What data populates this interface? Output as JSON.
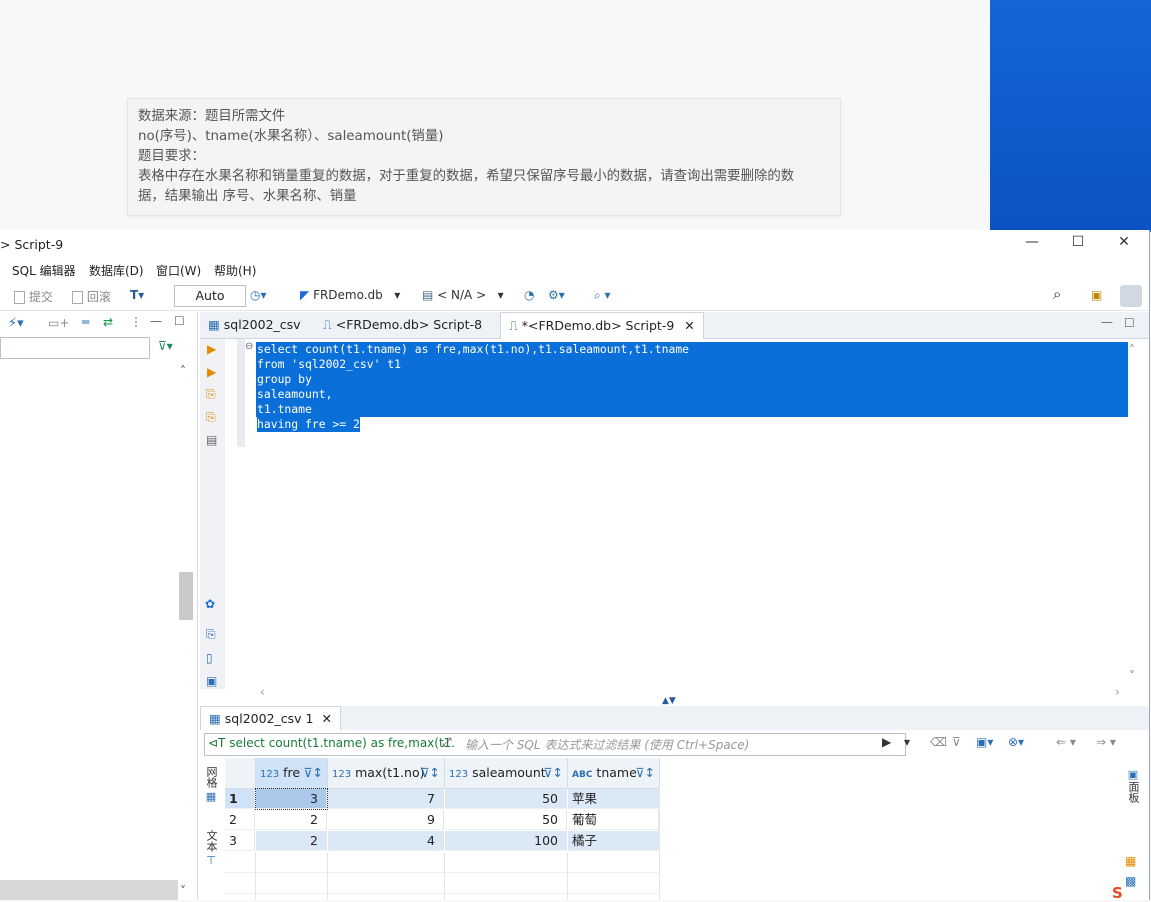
{
  "note": {
    "line1": "数据来源：题目所需文件",
    "line2": "no(序号)、tname(水果名称）、saleamount(销量)",
    "line3": "题目要求：",
    "line4": "表格中存在水果名称和销量重复的数据，对于重复的数据，希望只保留序号最小的数据，请查询出需要删除的数",
    "line5": "据，结果输出 序号、水果名称、销量"
  },
  "window": {
    "title": "> Script-9",
    "minimize": "—",
    "maximize": "☐",
    "close": "✕"
  },
  "menu": [
    "SQL 编辑器",
    "数据库(D)",
    "窗口(W)",
    "帮助(H)"
  ],
  "toolbar": {
    "commit": "提交",
    "rollback": "回滚",
    "mode": "Auto",
    "datasource": "FRDemo.db",
    "schema": "< N/A >"
  },
  "tabs": [
    {
      "label": "sql2002_csv"
    },
    {
      "label": "<FRDemo.db> Script-8"
    },
    {
      "label": "*<FRDemo.db> Script-9",
      "close": "✕"
    }
  ],
  "editor": {
    "lines": [
      "select count(t1.tname) as fre,max(t1.no),t1.saleamount,t1.tname",
      "from 'sql2002_csv' t1",
      "group by",
      "saleamount,",
      "t1.tname",
      "having fre >= 2"
    ]
  },
  "results": {
    "tab": "sql2002_csv 1",
    "tab_close": "✕",
    "query_preview": "select count(t1.tname) as fre,max(t1.",
    "filter_placeholder": "输入一个 SQL 表达式来过滤结果 (使用 Ctrl+Space)",
    "side_grid": "网格",
    "side_text": "文本",
    "panel_label": "面板",
    "columns": [
      {
        "type": "123",
        "name": "fre"
      },
      {
        "type": "123",
        "name": "max(t1.no)"
      },
      {
        "type": "123",
        "name": "saleamount"
      },
      {
        "type": "ABC",
        "name": "tname"
      }
    ],
    "rows": [
      {
        "n": "1",
        "fre": "3",
        "max": "7",
        "sale": "50",
        "tname": "苹果"
      },
      {
        "n": "2",
        "fre": "2",
        "max": "9",
        "sale": "50",
        "tname": "葡萄"
      },
      {
        "n": "3",
        "fre": "2",
        "max": "4",
        "sale": "100",
        "tname": "橘子"
      }
    ]
  },
  "colors": {
    "selection": "#0a6fd8",
    "desktop": "#1565d8"
  }
}
